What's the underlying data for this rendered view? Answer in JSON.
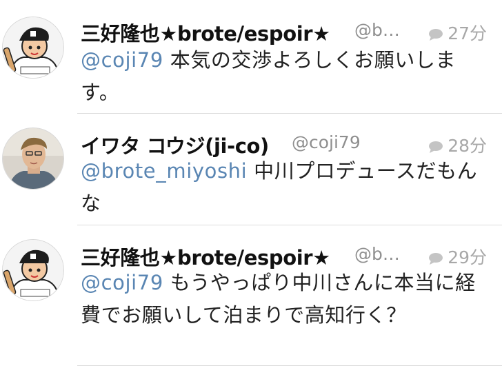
{
  "tweets": [
    {
      "name": "三好隆也★brote/espoir★",
      "handle": "@b…",
      "time": "27分",
      "mention": "@coji79",
      "text": " 本気の交渉よろしくお願いします。"
    },
    {
      "name": "イワタ コウジ(ji-co)",
      "handle": "@coji79",
      "time": "28分",
      "mention": "@brote_miyoshi",
      "text": " 中川プロデュースだもんな"
    },
    {
      "name": "三好隆也★brote/espoir★",
      "handle": "@b…",
      "time": "29分",
      "mention": "@coji79",
      "text": " もうやっぱり中川さんに本当に経費でお願いして泊まりで高知行く？"
    }
  ],
  "colors": {
    "mention": "#5a86b3",
    "meta": "#a8a8a8",
    "divider": "#dcdcdc"
  }
}
